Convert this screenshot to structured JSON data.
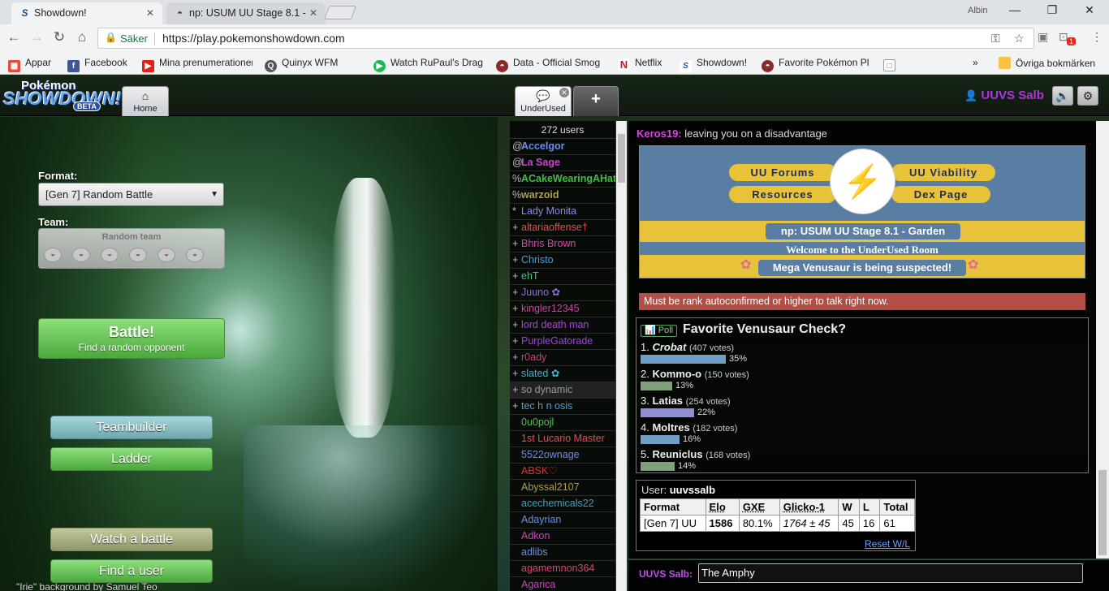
{
  "browser": {
    "tabs": [
      {
        "title": "Showdown!",
        "favicon": "S"
      },
      {
        "title": "np: USUM UU Stage 8.1 -",
        "favicon": "◓"
      }
    ],
    "profile_name": "Albin",
    "secure_label": "Säker",
    "url": "https://play.pokemonshowdown.com",
    "bookmarks": [
      {
        "label": "Appar",
        "color": "#e34a3a",
        "icon": "▦"
      },
      {
        "label": "Facebook",
        "color": "#3b5998",
        "icon": "f"
      },
      {
        "label": "Mina prenumerationer",
        "color": "#e62117",
        "icon": "▶"
      },
      {
        "label": "Quinyx WFM",
        "color": "#555555",
        "icon": "Q"
      },
      {
        "label": "Watch RuPaul's Drag",
        "color": "#1db954",
        "icon": "▶"
      },
      {
        "label": "Data - Official Smog",
        "color": "#8a2a2a",
        "icon": "◓"
      },
      {
        "label": "Netflix",
        "color": "#e50914",
        "icon": "N"
      },
      {
        "label": "Showdown!",
        "color": "#1d4f9c",
        "icon": "S"
      },
      {
        "label": "Favorite Pokémon Pl",
        "color": "#8a2a2a",
        "icon": "◓"
      },
      {
        "label": "",
        "color": "#999999",
        "icon": "□"
      }
    ],
    "more_bookmarks": "»",
    "other_bookmarks": "Övriga bokmärken",
    "ext_badge": "1"
  },
  "header": {
    "logo": {
      "top": "Pokémon",
      "main": "SHOWDOWN!",
      "beta": "BETA"
    },
    "tabs": [
      {
        "icon": "⌂",
        "label": "Home"
      },
      {
        "icon": "💬",
        "label": "UnderUsed"
      },
      {
        "icon": "+",
        "label": ""
      }
    ],
    "user": "UUVS Salb",
    "sound_icon": "🔈",
    "settings_icon": "⚙"
  },
  "home": {
    "format_label": "Format:",
    "format_value": "[Gen 7] Random Battle",
    "team_label": "Team:",
    "team_value": "Random team",
    "battle_title": "Battle!",
    "battle_sub": "Find a random opponent",
    "teambuilder": "Teambuilder",
    "ladder": "Ladder",
    "watch": "Watch a battle",
    "find_user": "Find a user",
    "credit": "\"Irie\" background by Samuel Teo"
  },
  "userlist": {
    "count": "272 users",
    "users": [
      {
        "group": "@",
        "name": "Accelgor",
        "color": "#6a8cf0",
        "auth": true
      },
      {
        "group": "@",
        "name": "La Sage",
        "color": "#d040d0",
        "auth": true
      },
      {
        "group": "%",
        "name": "ACakeWearingAHat",
        "color": "#40c040",
        "auth": true
      },
      {
        "group": "%",
        "name": "warzoid",
        "color": "#b4a040",
        "auth": true
      },
      {
        "group": "*",
        "name": "Lady Monita",
        "color": "#8a8af0",
        "auth": false
      },
      {
        "group": "+",
        "name": "altariaoffense†",
        "color": "#e05050",
        "auth": false
      },
      {
        "group": "+",
        "name": "Bhris Brown",
        "color": "#e040b0",
        "auth": false
      },
      {
        "group": "+",
        "name": "Christo",
        "color": "#40a0e0",
        "auth": false
      },
      {
        "group": "+",
        "name": "ehT",
        "color": "#40c080",
        "auth": false
      },
      {
        "group": "+",
        "name": "Juuno ✿",
        "color": "#8a70e0",
        "auth": false
      },
      {
        "group": "+",
        "name": "kingler12345",
        "color": "#d040a0",
        "auth": false
      },
      {
        "group": "+",
        "name": "lord death man",
        "color": "#b040e0",
        "auth": false
      },
      {
        "group": "+",
        "name": "PurpleGatorade",
        "color": "#a040e0",
        "auth": false
      },
      {
        "group": "+",
        "name": "r0ady",
        "color": "#d04070",
        "auth": false
      },
      {
        "group": "+",
        "name": "slated ✿",
        "color": "#40b0e0",
        "auth": false
      },
      {
        "group": "+",
        "name": "so dynamic",
        "color": "#9a9a9a",
        "auth": false,
        "away": true
      },
      {
        "group": "+",
        "name": "tec h n osis",
        "color": "#50a0e0",
        "auth": false
      },
      {
        "group": "",
        "name": "0u0pojl",
        "color": "#50c050",
        "auth": false
      },
      {
        "group": "",
        "name": "1st Lucario Master",
        "color": "#e05050",
        "auth": false
      },
      {
        "group": "",
        "name": "5522ownage",
        "color": "#6a8cf0",
        "auth": false
      },
      {
        "group": "",
        "name": "ABSK♡",
        "color": "#e03030",
        "auth": false
      },
      {
        "group": "",
        "name": "Abyssal2107",
        "color": "#b0a040",
        "auth": false
      },
      {
        "group": "",
        "name": "acechemicals22",
        "color": "#40a0c0",
        "auth": false
      },
      {
        "group": "",
        "name": "Adayrian",
        "color": "#6a8cf0",
        "auth": false
      },
      {
        "group": "",
        "name": "Adkon",
        "color": "#d040c0",
        "auth": false
      },
      {
        "group": "",
        "name": "adlibs",
        "color": "#6a8cf0",
        "auth": false
      },
      {
        "group": "",
        "name": "agamemnon364",
        "color": "#e04070",
        "auth": false
      },
      {
        "group": "",
        "name": "Agarica",
        "color": "#d040c0",
        "auth": false
      }
    ]
  },
  "chat": {
    "message": {
      "user": "Keros19:",
      "text": "leaving you on a disadvantage"
    },
    "banner": {
      "links": [
        "UU Forums",
        "UU Viability",
        "Resources",
        "Dex Page"
      ],
      "mascot_icon": "⚡",
      "np": "np: USUM UU Stage 8.1 - Garden",
      "welcome": "Welcome to the UnderUsed Room",
      "suspect": "Mega Venusaur is being suspected!",
      "flower_icon": "✿"
    },
    "restriction": "Must be rank autoconfirmed or higher to talk right now.",
    "poll": {
      "tag": "📊 Poll",
      "title": "Favorite Venusaur Check?",
      "options": [
        {
          "num": "1.",
          "name": "Crobat",
          "votes": "(407 votes)",
          "pct": "35%",
          "value": 35,
          "color": "#6f9ec6",
          "italic": true
        },
        {
          "num": "2.",
          "name": "Kommo-o",
          "votes": "(150 votes)",
          "pct": "13%",
          "value": 13,
          "color": "#7fa07a",
          "italic": false
        },
        {
          "num": "3.",
          "name": "Latias",
          "votes": "(254 votes)",
          "pct": "22%",
          "value": 22,
          "color": "#8f8fd6",
          "italic": false
        },
        {
          "num": "4.",
          "name": "Moltres",
          "votes": "(182 votes)",
          "pct": "16%",
          "value": 16,
          "color": "#6f9ec6",
          "italic": false
        },
        {
          "num": "5.",
          "name": "Reuniclus",
          "votes": "(168 votes)",
          "pct": "14%",
          "value": 14,
          "color": "#7fa07a",
          "italic": false
        }
      ]
    },
    "stats": {
      "user_label": "User:",
      "user": "uuvssalb",
      "headers": [
        "Format",
        "Elo",
        "GXE",
        "Glicko-1",
        "W",
        "L",
        "Total"
      ],
      "row": [
        "[Gen 7] UU",
        "1586",
        "80.1%",
        "1764 ± 45",
        "45",
        "16",
        "61"
      ],
      "reset": "Reset W/L"
    },
    "input": {
      "user": "UUVS Salb:",
      "value": "The Amphy"
    }
  }
}
